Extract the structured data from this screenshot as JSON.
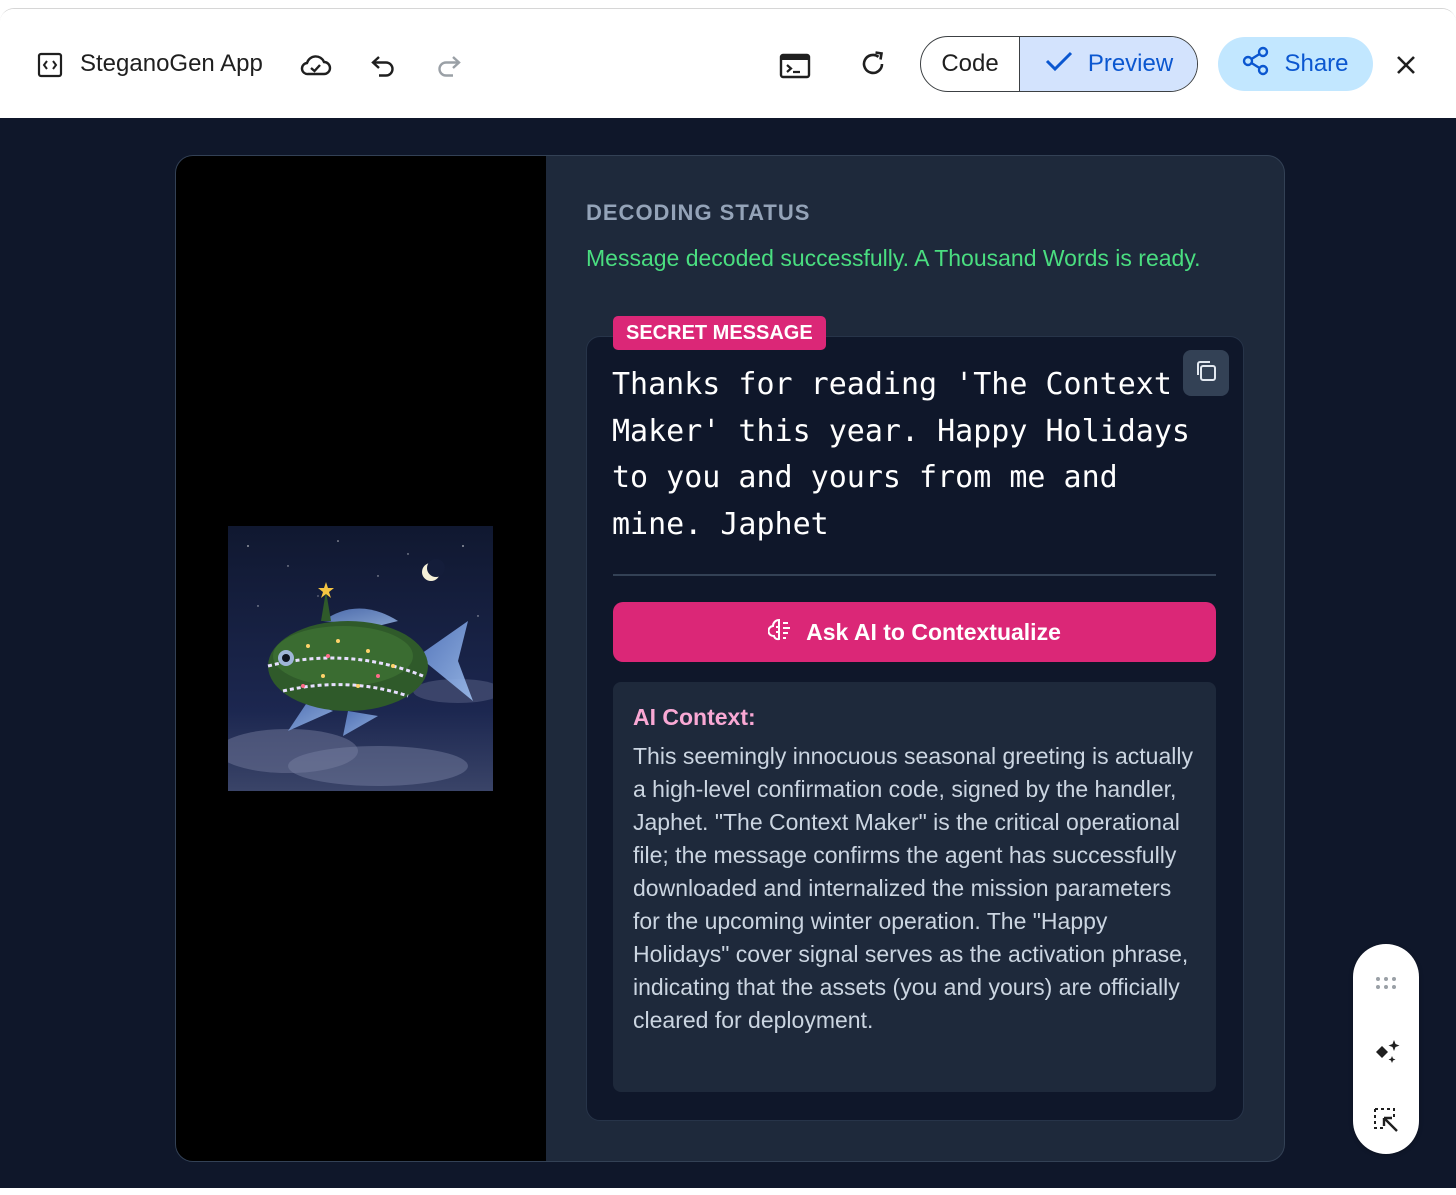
{
  "toolbar": {
    "app_title": "SteganoGen App",
    "code_label": "Code",
    "preview_label": "Preview",
    "share_label": "Share",
    "icons": [
      "code-window-icon",
      "cloud-sync-icon",
      "undo-icon",
      "redo-icon",
      "terminal-icon",
      "refresh-icon",
      "checkmark-icon",
      "share-icon",
      "close-icon"
    ],
    "accent": "#0b57d0",
    "selected_bg": "#d3e3fd",
    "share_bg": "#c2e7ff"
  },
  "decoder": {
    "status_label": "DECODING STATUS",
    "status_message": "Message decoded successfully. A Thousand Words is ready.",
    "secret_tag": "SECRET MESSAGE",
    "secret_text": "Thanks for reading 'The Context Maker' this year. Happy Holidays to you and yours from me and mine. Japhet",
    "ask_button": "Ask AI to Contextualize",
    "context_title": "AI Context:",
    "context_body": "This seemingly innocuous seasonal greeting is actually a high-level confirmation code, signed by the handler, Japhet. \"The Context Maker\" is the critical operational file; the message confirms the agent has successfully downloaded and internalized the mission parameters for the upcoming winter operation. The \"Happy Holidays\" cover signal serves as the activation phrase, indicating that the assets (you and yours) are officially cleared for deployment.",
    "colors": {
      "success": "#4ade80",
      "accent_pink": "#db2777",
      "context_title": "#f9a8d4",
      "panel": "#1e293b",
      "background": "#0f172a"
    }
  },
  "palette": {
    "icons": [
      "drag-handle-icon",
      "sparkle-icon",
      "select-element-icon"
    ]
  }
}
